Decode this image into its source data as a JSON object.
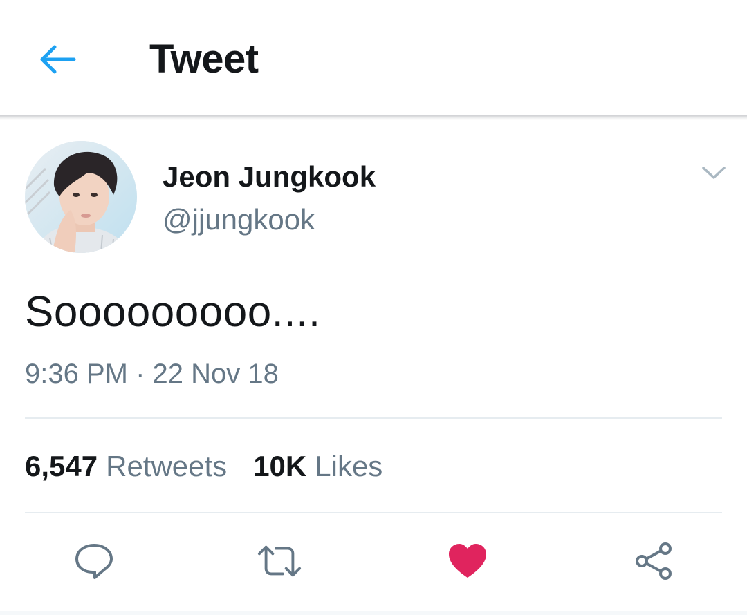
{
  "header": {
    "title": "Tweet",
    "back_icon": "arrow-left-icon",
    "accent_color": "#1da1f2"
  },
  "tweet": {
    "display_name": "Jeon Jungkook",
    "handle": "@jjungkook",
    "text": "Sooooooooo....",
    "time": "9:36 PM",
    "separator": "·",
    "date": "22 Nov 18",
    "menu_icon": "chevron-down-icon"
  },
  "stats": {
    "retweets_count": "6,547",
    "retweets_label": "Retweets",
    "likes_count": "10K",
    "likes_label": "Likes"
  },
  "actions": {
    "reply_icon": "comment-bubble-icon",
    "retweet_icon": "retweet-icon",
    "like_icon": "heart-icon",
    "like_state": "liked",
    "like_color": "#e0245e",
    "share_icon": "share-icon",
    "icon_color": "#657786"
  }
}
